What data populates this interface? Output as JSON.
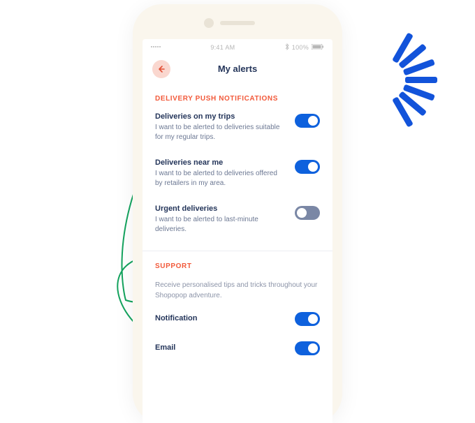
{
  "statusbar": {
    "signal_label": "signal",
    "carrier": "",
    "time": "9:41 AM",
    "bluetooth": "bluetooth",
    "battery_pct": "100%"
  },
  "nav": {
    "title": "My alerts",
    "back_icon": "arrow-left"
  },
  "sections": {
    "delivery": {
      "header": "DELIVERY PUSH NOTIFICATIONS",
      "rows": [
        {
          "title": "Deliveries on my trips",
          "desc": "I want to be alerted to deliveries suitable for my regular trips.",
          "on": true
        },
        {
          "title": "Deliveries near me",
          "desc": "I want to be alerted to deliveries offered by retailers in my area.",
          "on": true
        },
        {
          "title": "Urgent deliveries",
          "desc": "I want to be alerted to last-minute deliveries.",
          "on": false
        }
      ]
    },
    "support": {
      "header": "SUPPORT",
      "desc": "Receive personalised tips and tricks throughout your Shopopop adventure.",
      "rows": [
        {
          "title": "Notification",
          "on": true
        },
        {
          "title": "Email",
          "on": true
        }
      ]
    }
  },
  "colors": {
    "accent": "#0E61DD",
    "section_header": "#F2593A",
    "text_primary": "#24355A",
    "text_muted": "#8C94A8",
    "bg_circles": "#F6A623",
    "arrow": "#14A35E"
  }
}
